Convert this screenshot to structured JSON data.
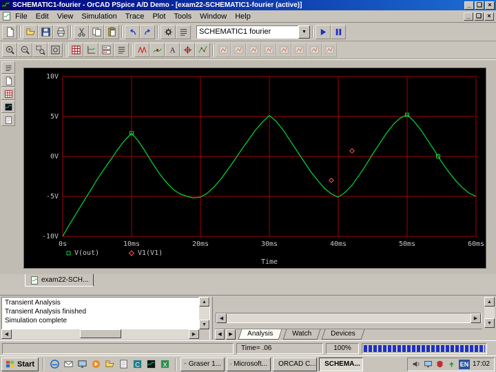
{
  "titlebar": {
    "title": "SCHEMATIC1-fourier - OrCAD PSpice A/D Demo - [exam22-SCHEMATIC1-fourier (active)]"
  },
  "menubar": {
    "items": [
      "File",
      "Edit",
      "View",
      "Simulation",
      "Trace",
      "Plot",
      "Tools",
      "Window",
      "Help"
    ]
  },
  "toolbars": {
    "profile_value": "SCHEMATIC1 fourier",
    "row1_groups": [
      [
        "new-simulation"
      ],
      [
        "open-file",
        "save-file",
        "print"
      ],
      [
        "cut",
        "copy",
        "paste"
      ],
      [
        "undo",
        "redo"
      ],
      [
        "simulation-settings",
        "view-output-file"
      ]
    ],
    "row1_actions": [
      "run-simulation",
      "pause-simulation"
    ],
    "row2_groups": [
      [
        "zoom-in",
        "zoom-out",
        "zoom-area",
        "zoom-fit"
      ],
      [
        "plot-grid",
        "add-y-axis",
        "add-plot",
        "view-netlist"
      ],
      [
        "add-trace",
        "eval-goal-function",
        "insert-text-label",
        "toggle-cursor",
        "mark-data-points"
      ]
    ],
    "row2_disabled": [
      "cursor-peak",
      "cursor-trough",
      "cursor-slope",
      "cursor-min",
      "cursor-max",
      "cursor-point",
      "cursor-search",
      "cursor-next-transition"
    ]
  },
  "left_strip": [
    "output-window",
    "schematic-page",
    "simulation-queue",
    "data-file",
    "watch-list"
  ],
  "plot": {
    "doc_tab": "exam22-SCH..."
  },
  "chart_data": {
    "type": "line",
    "title": "",
    "xlabel": "Time",
    "x_ticks": [
      {
        "label": "0s",
        "t": 0
      },
      {
        "label": "10ms",
        "t": 10
      },
      {
        "label": "20ms",
        "t": 20
      },
      {
        "label": "30ms",
        "t": 30
      },
      {
        "label": "40ms",
        "t": 40
      },
      {
        "label": "50ms",
        "t": 50
      },
      {
        "label": "60ms",
        "t": 60
      }
    ],
    "y_ticks": [
      {
        "label": "10V",
        "v": 10
      },
      {
        "label": "5V",
        "v": 5
      },
      {
        "label": "0V",
        "v": 0
      },
      {
        "label": "-5V",
        "v": -5
      },
      {
        "label": "-10V",
        "v": -10
      }
    ],
    "x_range": [
      0,
      60
    ],
    "y_range": [
      -10,
      10
    ],
    "grid_on": true,
    "grid_color": "#a40000",
    "bg_color": "#000000",
    "label_color": "#c8c8c8",
    "legend_position": "bottom-left",
    "series": [
      {
        "name": "V(out)",
        "color": "#00dc3c",
        "marker": "square",
        "points": [
          [
            0,
            -10
          ],
          [
            1,
            -8.5
          ],
          [
            2,
            -7.1
          ],
          [
            3,
            -5.7
          ],
          [
            4,
            -4.3
          ],
          [
            5,
            -2.9
          ],
          [
            6,
            -1.6
          ],
          [
            7,
            -0.4
          ],
          [
            8,
            0.9
          ],
          [
            9,
            2
          ],
          [
            10,
            2.9
          ],
          [
            11,
            1.9
          ],
          [
            12,
            0.6
          ],
          [
            13,
            -0.8
          ],
          [
            14,
            -2.1
          ],
          [
            15,
            -3.2
          ],
          [
            16,
            -4.1
          ],
          [
            17,
            -4.7
          ],
          [
            18,
            -5
          ],
          [
            19,
            -5.2
          ],
          [
            20,
            -5.1
          ],
          [
            21,
            -4.6
          ],
          [
            22,
            -3.8
          ],
          [
            23,
            -2.8
          ],
          [
            24,
            -1.6
          ],
          [
            25,
            -0.4
          ],
          [
            26,
            0.9
          ],
          [
            27,
            2.1
          ],
          [
            28,
            3.3
          ],
          [
            29,
            4.3
          ],
          [
            30,
            5.1
          ],
          [
            31,
            4.4
          ],
          [
            32,
            3.3
          ],
          [
            33,
            2
          ],
          [
            34,
            0.7
          ],
          [
            35,
            -0.6
          ],
          [
            36,
            -1.9
          ],
          [
            37,
            -3
          ],
          [
            38,
            -4
          ],
          [
            39,
            -4.7
          ],
          [
            40,
            -5.1
          ],
          [
            41,
            -4.5
          ],
          [
            42,
            -3.6
          ],
          [
            43,
            -2.4
          ],
          [
            44,
            -1.1
          ],
          [
            45,
            0.3
          ],
          [
            46,
            1.6
          ],
          [
            47,
            2.9
          ],
          [
            48,
            4
          ],
          [
            49,
            4.8
          ],
          [
            50,
            5.2
          ],
          [
            51,
            4.4
          ],
          [
            52,
            3.3
          ],
          [
            53,
            2
          ],
          [
            54,
            0.7
          ],
          [
            55,
            -0.7
          ],
          [
            56,
            -1.9
          ],
          [
            57,
            -3
          ],
          [
            58,
            -3.9
          ],
          [
            59,
            -4.6
          ],
          [
            60,
            -5
          ]
        ],
        "marker_points": [
          [
            10,
            2.9
          ],
          [
            50,
            5.2
          ],
          [
            54.5,
            0
          ]
        ]
      },
      {
        "name": "V1(V1)",
        "color": "#ff5a5a",
        "marker": "diamond",
        "points": [],
        "marker_points": [
          [
            39,
            -3
          ],
          [
            42,
            0.7
          ]
        ]
      }
    ]
  },
  "output_log": {
    "lines": [
      "Transient Analysis",
      "Transient Analysis finished",
      "Simulation complete"
    ]
  },
  "bottom_tabs": {
    "items": [
      "Analysis",
      "Watch",
      "Devices"
    ],
    "selected_index": 0
  },
  "statusbar": {
    "time_text": "Time= .06",
    "progress_text": "100%"
  },
  "taskbar": {
    "start_label": "Start",
    "quick_launch": [
      "internet-explorer",
      "outlook-mail",
      "show-desktop",
      "media-player",
      "folder",
      "notepad",
      "orcad-capture",
      "pspice",
      "spreadsheet"
    ],
    "tasks": [
      {
        "label": "Graser 1...",
        "icon": "graser",
        "active": false
      },
      {
        "label": "Microsoft...",
        "icon": "word",
        "active": false
      },
      {
        "label": "ORCAD C...",
        "icon": "capture",
        "active": false
      },
      {
        "label": "SCHEMA...",
        "icon": "pspice",
        "active": true
      }
    ],
    "tray": {
      "icons": [
        "updates",
        "antivirus",
        "display",
        "volume"
      ],
      "lang": "EN",
      "clock": "17:02"
    }
  }
}
